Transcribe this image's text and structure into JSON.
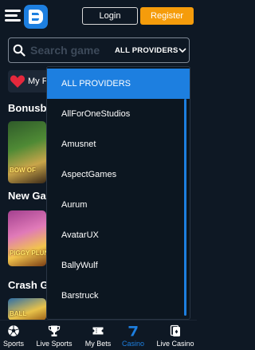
{
  "header": {
    "login_label": "Login",
    "register_label": "Register"
  },
  "search": {
    "placeholder": "Search game",
    "providers_label": "ALL PROVIDERS"
  },
  "favorites": {
    "label": "My F"
  },
  "sections": [
    {
      "title": "Bonusb"
    },
    {
      "title": "New Ga"
    },
    {
      "title": "Crash G"
    }
  ],
  "thumbnails": [
    {
      "label": "BOW OF"
    },
    {
      "label": "PIGGY PLUN"
    },
    {
      "label": "BALL"
    }
  ],
  "providers_dropdown": {
    "items": [
      {
        "label": "ALL PROVIDERS",
        "selected": true
      },
      {
        "label": "AllForOneStudios",
        "selected": false
      },
      {
        "label": "Amusnet",
        "selected": false
      },
      {
        "label": "AspectGames",
        "selected": false
      },
      {
        "label": "Aurum",
        "selected": false
      },
      {
        "label": "AvatarUX",
        "selected": false
      },
      {
        "label": "BallyWulf",
        "selected": false
      },
      {
        "label": "Barstruck",
        "selected": false
      }
    ]
  },
  "bottom_nav": {
    "items": [
      {
        "label": "Sports",
        "icon": "soccer-ball-icon",
        "active": false
      },
      {
        "label": "Live Sports",
        "icon": "trophy-icon",
        "active": false
      },
      {
        "label": "My Bets",
        "icon": "ticket-icon",
        "active": false
      },
      {
        "label": "Casino",
        "icon": "seven-icon",
        "active": true
      },
      {
        "label": "Live Casino",
        "icon": "cards-icon",
        "active": false
      }
    ]
  },
  "colors": {
    "background": "#0e1824",
    "accent": "#1d7fe0",
    "register": "#f59c0b"
  }
}
